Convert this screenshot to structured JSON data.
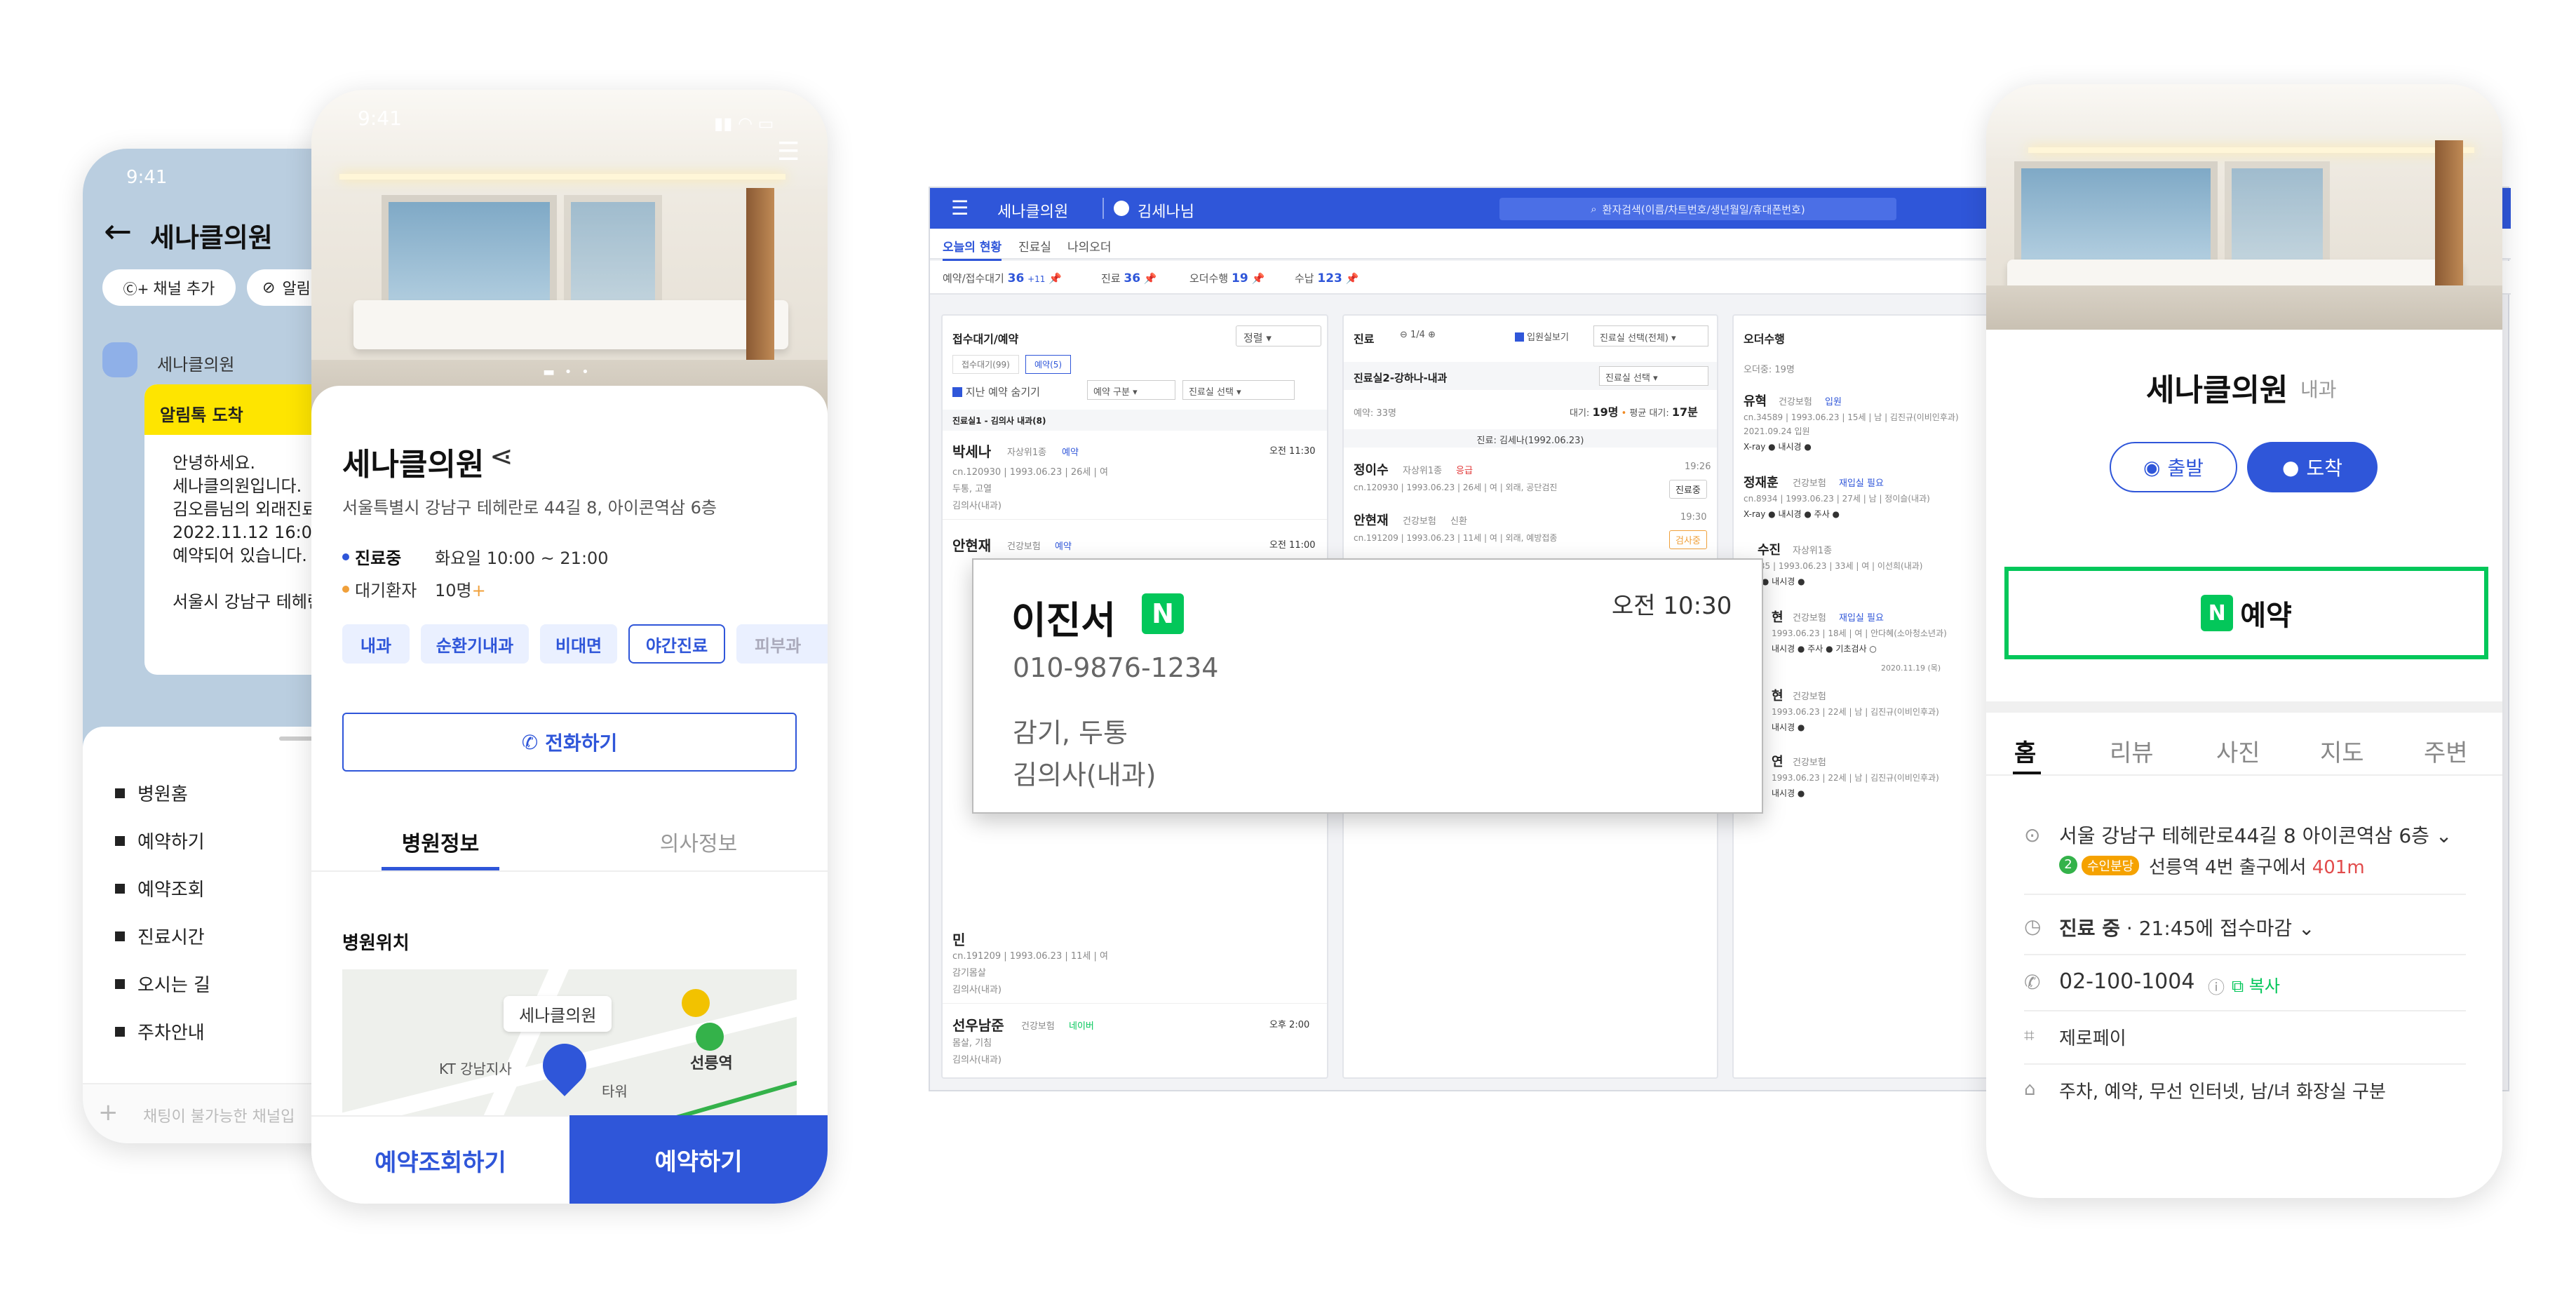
{
  "kakao": {
    "time": "9:41",
    "title": "세나클의원",
    "add_channel": "채널 추가",
    "alarm": "알림",
    "sender": "세나클의원",
    "badge": "알림톡 도착",
    "message": [
      "안녕하세요.",
      "세나클의원입니다.",
      "김오름님의 외래진료",
      "2022.11.12 16:00",
      "예약되어 있습니다.",
      "",
      "서울시 강남구 테헤란"
    ],
    "menu": [
      "병원홈",
      "예약하기",
      "예약조회",
      "진료시간",
      "오시는 길",
      "주차안내"
    ],
    "input_placeholder": "채팅이 불가능한 채널입"
  },
  "app": {
    "time": "9:41",
    "name": "세나클의원",
    "address": "서울특별시 강남구 테헤란로 44길 8, 아이콘역삼 6층",
    "status_label": "진료중",
    "hours": "화요일 10:00 ~ 21:00",
    "wait_label": "대기환자",
    "wait_value": "10명",
    "tags": [
      "내과",
      "순환기내과",
      "비대면",
      "야간진료",
      "피부과"
    ],
    "call_button": "전화하기",
    "tab_info": "병원정보",
    "tab_doctor": "의사정보",
    "location_title": "병원위치",
    "map_labels": {
      "clinic": "세나클의원",
      "kt": "KT 강남지사",
      "station": "선릉역",
      "tower": "타워"
    },
    "bottom_left": "예약조회하기",
    "bottom_right": "예약하기"
  },
  "dash": {
    "brand": "세나클의원",
    "user": "김세나님",
    "search_placeholder": "환자검색(이름/차트번호/생년월일/휴대폰번호)",
    "tabs": [
      "오늘의 현황",
      "진료실",
      "나의오더"
    ],
    "stats": [
      {
        "label": "예약/접수대기",
        "value": "36",
        "extra": "+11"
      },
      {
        "label": "진료",
        "value": "36"
      },
      {
        "label": "오더수행",
        "value": "19"
      },
      {
        "label": "수납",
        "value": "123"
      }
    ],
    "col1": {
      "title": "접수대기/예약",
      "sort": "정렬",
      "sub_tabs": [
        "접수대기(99)",
        "예약(5)"
      ],
      "hide_past": "지난 예약 숨기기",
      "filter1": "예약 구분",
      "filter2": "진료실 선택",
      "group": "진료실1 - 김의사 내과(8)",
      "patients": [
        {
          "name": "박세나",
          "ins": "자상위1종",
          "badge": "예약",
          "time": "오전 11:30",
          "info": "cn.120930 | 1993.06.23 | 26세 | 여",
          "memo": "두통, 고열",
          "doc": "김의사(내과)"
        },
        {
          "name": "안현재",
          "ins": "건강보험",
          "badge": "예약",
          "time": "오전 11:00",
          "info": "",
          "memo": "",
          "doc": ""
        },
        {
          "name": "민",
          "ins": "",
          "badge": "",
          "time": "",
          "info": "cn.191209 | 1993.06.23 | 11세 | 여",
          "memo": "감기몸살",
          "doc": "김의사(내과)"
        },
        {
          "name": "선우남준",
          "ins": "건강보험",
          "badge": "네이버",
          "time": "오후 2:00",
          "info": "몸살, 기침",
          "memo": "",
          "doc": "김의사(내과)"
        }
      ]
    },
    "col2": {
      "title": "진료",
      "page": "1/4",
      "chk": "입원실보기",
      "room_select": "진료실 선택(전체)",
      "room": "진료실2-강하나-내과",
      "room_sel": "진료실 선택",
      "reserve": "예약: 33명",
      "wait_label": "대기:",
      "wait": "19명",
      "avg_label": "평균 대기:",
      "avg": "17분",
      "current": "진료: 김세나(1992.06.23)",
      "patients": [
        {
          "name": "정이수",
          "ins": "자상위1종",
          "flag": "응급",
          "time": "19:26",
          "info": "cn.120930 | 1993.06.23 | 26세 | 여 | 외래, 공단검진",
          "btn": "진료중"
        },
        {
          "name": "안현재",
          "ins": "건강보험",
          "flag": "신환",
          "time": "19:30",
          "info": "cn.191209 | 1993.06.23 | 11세 | 여 | 외래, 예방접종",
          "btn": "검사중"
        }
      ]
    },
    "col3": {
      "title": "오더수행",
      "wait": "오더중: 19명",
      "patients": [
        {
          "name": "유혁",
          "ins": "건강보험",
          "badge": "입원",
          "info": "cn.34589 | 1993.06.23 | 15세 | 남 | 김진규(이비인후과)",
          "date": "2021.09.24 입원",
          "orders": "X-ray ● 내시경 ●"
        },
        {
          "name": "정재훈",
          "ins": "건강보험",
          "badge": "재입실 필요",
          "info": "cn.8934 | 1993.06.23 | 27세 | 남 | 정이슬(내과)",
          "orders": "X-ray ● 내시경 ● 주사 ●"
        },
        {
          "name": "수진",
          "ins": "자상위1종",
          "info": "02335 | 1993.06.23 | 33세 | 여 | 이선희(내과)",
          "orders": "혈액 ● 내시경 ●"
        },
        {
          "name": "현",
          "ins": "건강보험",
          "badge": "재입실 필요",
          "info": "1993.06.23 | 18세 | 여 | 안다혜(소아청소년과)",
          "orders": "내시경 ● 주사 ● 기초검사 ○",
          "date": "2020.11.19 (목)"
        },
        {
          "name": "현",
          "ins": "건강보험",
          "info": "1993.06.23 | 22세 | 남 | 김진규(이비인후과)",
          "orders": "내시경 ●"
        },
        {
          "name": "연",
          "ins": "건강보험",
          "info": "1993.06.23 | 22세 | 남 | 김진규(이비인후과)",
          "orders": "내시경 ●"
        }
      ]
    },
    "popup": {
      "name": "이진서",
      "badge": "N",
      "time": "오전 10:30",
      "phone": "010-9876-1234",
      "symptom": "감기, 두통",
      "doctor": "김의사(내과)"
    }
  },
  "naver": {
    "name": "세나클의원",
    "category": "내과",
    "depart": "출발",
    "arrive": "도착",
    "reserve_badge": "N",
    "reserve": "예약",
    "tabs": [
      "홈",
      "리뷰",
      "사진",
      "지도",
      "주변"
    ],
    "address": "서울 강남구 테헤란로44길 8 아이콘역삼 6층",
    "line_num": "2",
    "line_name": "수인분당",
    "station_dir": "선릉역 4번 출구에서",
    "distance": "401m",
    "status": "진료 중",
    "hours": "21:45에 접수마감",
    "phone": "02-100-1004",
    "copy": "복사",
    "pay": "제로페이",
    "amenities": "주차, 예약, 무선 인터넷, 남/녀 화장실 구분"
  },
  "colors": {
    "primary": "#2f56d9",
    "naver_green": "#03c75a",
    "kakao_bg": "#bacee0",
    "kakao_yellow": "#fee500"
  }
}
